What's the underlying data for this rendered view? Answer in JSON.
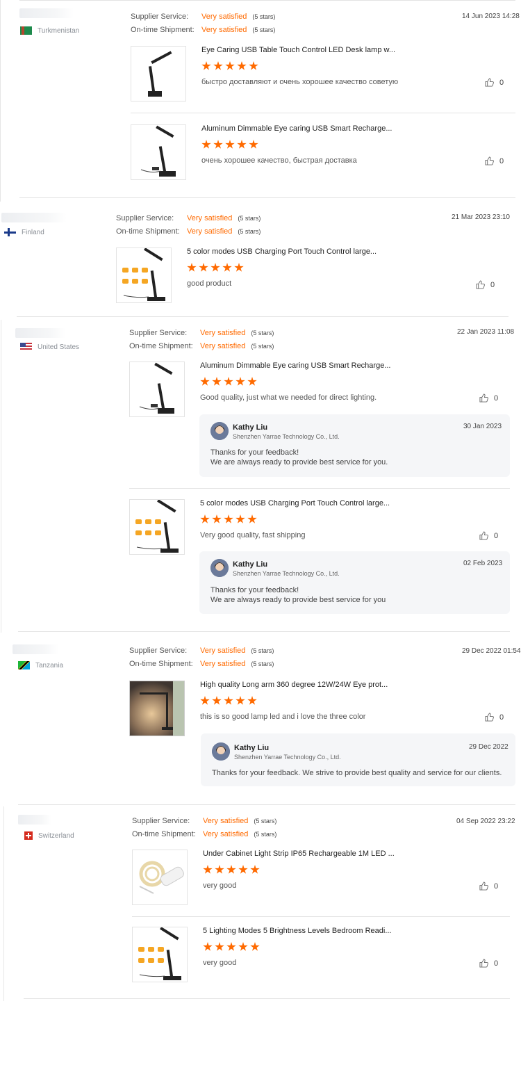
{
  "labels": {
    "supplier_service": "Supplier Service:",
    "on_time_shipment": "On-time Shipment:"
  },
  "icons": {
    "like": "thumbs-up-icon",
    "star": "star-icon"
  },
  "colors": {
    "accent": "#ff6a00",
    "reply_bg": "#f5f6f8",
    "divider": "#e3e3e3"
  },
  "reviews": [
    {
      "country": "Turkmenistan",
      "supplier_service": "Very satisfied",
      "supplier_stars": "(5 stars)",
      "shipment": "Very satisfied",
      "shipment_stars": "(5 stars)",
      "date": "14 Jun 2023 14:28",
      "items": [
        {
          "title": "Eye Caring USB Table Touch Control LED Desk lamp w...",
          "rating": 5,
          "comment": "быстро доставляют и очень хорошее качество советую",
          "likes": "0"
        },
        {
          "title": "Aluminum Dimmable Eye caring USB Smart Recharge...",
          "rating": 5,
          "comment": "очень хорошее качество,  быстрая доставка",
          "likes": "0"
        }
      ]
    },
    {
      "country": "Finland",
      "supplier_service": "Very satisfied",
      "supplier_stars": "(5 stars)",
      "shipment": "Very satisfied",
      "shipment_stars": "(5 stars)",
      "date": "21 Mar 2023 23:10",
      "items": [
        {
          "title": "5 color modes USB Charging Port Touch Control large...",
          "rating": 5,
          "comment": "good product",
          "likes": "0"
        }
      ]
    },
    {
      "country": "United States",
      "supplier_service": "Very satisfied",
      "supplier_stars": "(5 stars)",
      "shipment": "Very satisfied",
      "shipment_stars": "(5 stars)",
      "date": "22 Jan 2023 11:08",
      "items": [
        {
          "title": "Aluminum Dimmable Eye caring USB Smart Recharge...",
          "rating": 5,
          "comment": "Good quality, just what we needed for direct lighting.",
          "likes": "0",
          "reply": {
            "name": "Kathy Liu",
            "company": "Shenzhen Yarrae Technology Co., Ltd.",
            "date": "30 Jan 2023",
            "line1": "Thanks for your feedback!",
            "line2": "We are always ready to provide best service for you."
          }
        },
        {
          "title": "5 color modes USB Charging Port Touch Control large...",
          "rating": 5,
          "comment": "Very good quality, fast shipping",
          "likes": "0",
          "reply": {
            "name": "Kathy Liu",
            "company": "Shenzhen Yarrae Technology Co., Ltd.",
            "date": "02 Feb 2023",
            "line1": "Thanks for your feedback!",
            "line2": "We are always ready to provide best service for you"
          }
        }
      ]
    },
    {
      "country": "Tanzania",
      "supplier_service": "Very satisfied",
      "supplier_stars": "(5 stars)",
      "shipment": "Very satisfied",
      "shipment_stars": "(5 stars)",
      "date": "29 Dec 2022 01:54",
      "items": [
        {
          "title": "High quality Long arm 360 degree 12W/24W Eye prot...",
          "rating": 5,
          "comment": "this is so good lamp led and i love the three color",
          "likes": "0",
          "reply": {
            "name": "Kathy Liu",
            "company": "Shenzhen Yarrae Technology Co., Ltd.",
            "date": "29 Dec 2022",
            "line1": "Thanks for your feedback. We strive to provide best quality and service for our clients."
          }
        }
      ]
    },
    {
      "country": "Switzerland",
      "supplier_service": "Very satisfied",
      "supplier_stars": "(5 stars)",
      "shipment": "Very satisfied",
      "shipment_stars": "(5 stars)",
      "date": "04 Sep 2022 23:22",
      "items": [
        {
          "title": "Under Cabinet Light Strip IP65 Rechargeable 1M LED ...",
          "rating": 5,
          "comment": "very good",
          "likes": "0"
        },
        {
          "title": "5 Lighting Modes 5 Brightness Levels Bedroom Readi...",
          "rating": 5,
          "comment": "very good",
          "likes": "0"
        }
      ]
    }
  ]
}
